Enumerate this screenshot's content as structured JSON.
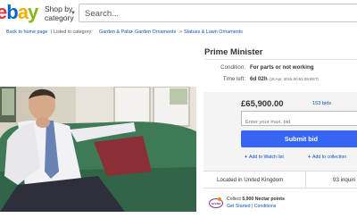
{
  "header": {
    "logo": {
      "l1": "e",
      "l2": "b",
      "l3": "a",
      "l4": "y"
    },
    "shop_by": {
      "line1": "Shop by",
      "line2": "category"
    },
    "search": {
      "placeholder": "Search..."
    }
  },
  "breadcrumb": {
    "back": "Back to home page",
    "listed_prefix": "| Listed in category:",
    "categories": [
      "Garden & Patio",
      "Garden Ornaments",
      "Statues & Lawn Ornaments"
    ],
    "separator": ">"
  },
  "item": {
    "title": "Prime Minister",
    "condition_label": "Condition:",
    "condition_value": "For parts or not working",
    "time_left_label": "Time left:",
    "time_left_value": "6d 02h",
    "time_left_detail": "(18 Apr, 2016  00:51:08 BST)"
  },
  "bid": {
    "price": "£65,900.00",
    "bids": "153 bids",
    "max_bid_placeholder": "Enter your max. bid",
    "submit_label": "Submit bid",
    "watch_label": "Add to Watch list",
    "collection_label": "Add to collection"
  },
  "shipping": {
    "location": "Located in United Kingdom",
    "inquiries": "93 inquiri"
  },
  "nectar": {
    "logo_text": "nectar",
    "collect_prefix": "Collect",
    "collect_points": "5,900 Nectar points",
    "get_started": "Get Started",
    "separator": "|",
    "conditions": "Conditions"
  },
  "colors": {
    "ebay_red": "#e53238",
    "ebay_blue": "#0064d2",
    "ebay_yellow": "#f5af02",
    "ebay_green": "#86b817",
    "link_blue": "#0654ba",
    "submit_blue": "#3665f3",
    "nectar_purple": "#7b3f98"
  }
}
